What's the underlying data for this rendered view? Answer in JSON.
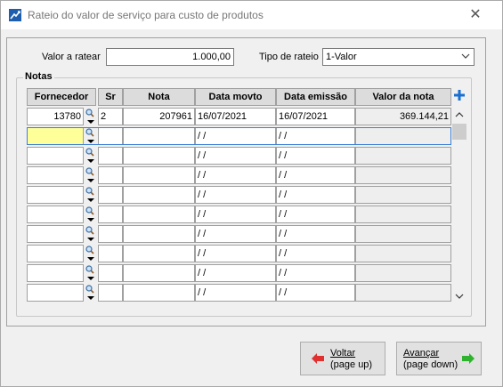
{
  "window": {
    "title": "Rateio do valor de serviço para custo de produtos"
  },
  "form": {
    "valor_label": "Valor a ratear",
    "valor_value": "1.000,00",
    "tipo_label": "Tipo de rateio",
    "tipo_value": "1-Valor"
  },
  "notas": {
    "group_title": "Notas",
    "columns": [
      "Fornecedor",
      "Sr",
      "Nota",
      "Data movto",
      "Data emissão",
      "Valor da nota"
    ],
    "rows": [
      {
        "fornecedor": "13780",
        "sr": "2",
        "nota": "207961",
        "data_movto": "16/07/2021",
        "data_emissao": "16/07/2021",
        "valor": "369.144,21"
      },
      {
        "fornecedor": "",
        "sr": "",
        "nota": "",
        "data_movto": " / /",
        "data_emissao": " / /",
        "valor": ""
      },
      {
        "fornecedor": "",
        "sr": "",
        "nota": "",
        "data_movto": " / /",
        "data_emissao": " / /",
        "valor": ""
      },
      {
        "fornecedor": "",
        "sr": "",
        "nota": "",
        "data_movto": " / /",
        "data_emissao": " / /",
        "valor": ""
      },
      {
        "fornecedor": "",
        "sr": "",
        "nota": "",
        "data_movto": " / /",
        "data_emissao": " / /",
        "valor": ""
      },
      {
        "fornecedor": "",
        "sr": "",
        "nota": "",
        "data_movto": " / /",
        "data_emissao": " / /",
        "valor": ""
      },
      {
        "fornecedor": "",
        "sr": "",
        "nota": "",
        "data_movto": " / /",
        "data_emissao": " / /",
        "valor": ""
      },
      {
        "fornecedor": "",
        "sr": "",
        "nota": "",
        "data_movto": " / /",
        "data_emissao": " / /",
        "valor": ""
      },
      {
        "fornecedor": "",
        "sr": "",
        "nota": "",
        "data_movto": " / /",
        "data_emissao": " / /",
        "valor": ""
      },
      {
        "fornecedor": "",
        "sr": "",
        "nota": "",
        "data_movto": " / /",
        "data_emissao": " / /",
        "valor": ""
      }
    ]
  },
  "buttons": {
    "voltar_line1": "Voltar",
    "voltar_line2": "(page up)",
    "avancar_line1": "Avançar",
    "avancar_line2": "(page down)"
  },
  "icons": {
    "app": "app-icon",
    "close": "close-icon",
    "lookup": "magnifier-dropdown-icon",
    "add": "plus-icon",
    "back": "red-left-arrow-icon",
    "forward": "green-right-arrow-icon"
  },
  "colors": {
    "active_cell": "#ffff99",
    "add_button": "#1a6fd1"
  }
}
